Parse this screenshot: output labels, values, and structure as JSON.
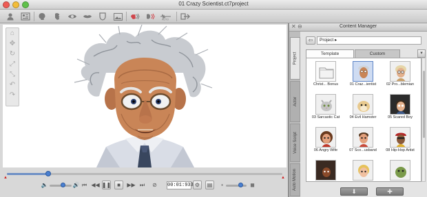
{
  "window": {
    "title": "01 Crazy Scientist.ct7project"
  },
  "toolbar": {
    "items": [
      {
        "icon": "actor-icon"
      },
      {
        "icon": "scene-icon"
      },
      {
        "icon": "head-icon"
      },
      {
        "icon": "face-icon"
      },
      {
        "icon": "eye-icon"
      },
      {
        "icon": "mouth-icon"
      },
      {
        "icon": "mask-icon"
      },
      {
        "icon": "image-icon"
      },
      {
        "icon": "audio-icon"
      },
      {
        "icon": "record-audio-icon"
      },
      {
        "icon": "waveform-icon"
      },
      {
        "icon": "export-icon"
      }
    ]
  },
  "playback": {
    "timecode": "00:01:933",
    "progress_fraction": 0.15
  },
  "content_manager": {
    "title": "Content Manager",
    "side_tabs": [
      "Project",
      "Actor",
      "Voice Script",
      "Auto Motion"
    ],
    "path": "Project",
    "tabs": {
      "template": "Template",
      "custom": "Custom"
    },
    "items": [
      {
        "label": "Christ... Bonus",
        "kind": "folder"
      },
      {
        "label": "01 Craz...ientist",
        "kind": "scientist",
        "selected": true
      },
      {
        "label": "02 Pro...blemian",
        "kind": "old-woman"
      },
      {
        "label": "03 Sarcastic Cat",
        "kind": "cat"
      },
      {
        "label": "04 Evil Hamster",
        "kind": "hamster"
      },
      {
        "label": "05 Scared Boy",
        "kind": "boy"
      },
      {
        "label": "06 Angry Wife",
        "kind": "wife"
      },
      {
        "label": "07 Sco...usband",
        "kind": "husband"
      },
      {
        "label": "08 Hip-Hop Artist",
        "kind": "hiphop"
      },
      {
        "label": "",
        "kind": "dark-man"
      },
      {
        "label": "",
        "kind": "blonde"
      },
      {
        "label": "",
        "kind": "green"
      }
    ]
  },
  "colors": {
    "accent": "#4a7fd0",
    "selection": "#cfdcf2",
    "panel": "#cfcfcf"
  }
}
